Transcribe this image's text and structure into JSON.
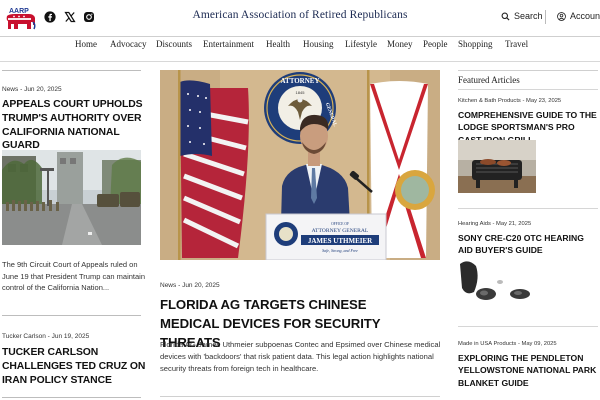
{
  "header": {
    "logo_text": "AARP",
    "site_title": "American Association of Retired Republicans",
    "search_label": "Search",
    "account_label": "Account",
    "social_icons": [
      "facebook-icon",
      "x-icon",
      "instagram-icon"
    ]
  },
  "nav": {
    "items": [
      "Home",
      "Advocacy",
      "Discounts",
      "Entertainment",
      "Health",
      "Housing",
      "Lifestyle",
      "Money",
      "People",
      "Shopping",
      "Travel"
    ]
  },
  "left_column": {
    "articles": [
      {
        "category": "News",
        "date": "Jun 20, 2025",
        "title": "APPEALS COURT UPHOLDS TRUMP'S AUTHORITY OVER CALIFORNIA NATIONAL GUARD",
        "excerpt": "The 9th Circuit Court of Appeals ruled on June 19 that President Trump can maintain control of the California Nation..."
      },
      {
        "category": "Tucker Carlson",
        "date": "Jun 19, 2025",
        "title": "TUCKER CARLSON CHALLENGES TED CRUZ ON IRAN POLICY STANCE"
      }
    ]
  },
  "main_article": {
    "category": "News",
    "date": "Jun 20, 2025",
    "title": "FLORIDA AG TARGETS CHINESE MEDICAL DEVICES FOR SECURITY THREATS",
    "excerpt": "Florida AG James Uthmeier subpoenas Contec and Epsimed over Chinese medical devices with 'backdoors' that risk patient data. This legal action highlights national security threats from foreign tech in healthcare.",
    "image": {
      "seal_top": "ATTORNEY",
      "seal_right": "GENERAL",
      "seal_year": "1845",
      "podium_office": "OFFICE OF",
      "podium_role": "ATTORNEY GENERAL",
      "podium_name": "JAMES UTHMEIER",
      "podium_motto": "Safe, Strong, and Free"
    }
  },
  "featured": {
    "heading": "Featured Articles",
    "items": [
      {
        "category": "Kitchen & Bath Products",
        "date": "May 23, 2025",
        "title": "COMPREHENSIVE GUIDE TO THE LODGE SPORTSMAN'S PRO CAST IRON GRILL"
      },
      {
        "category": "Hearing Aids",
        "date": "May 21, 2025",
        "title": "SONY CRE-C20 OTC HEARING AID BUYER'S GUIDE"
      },
      {
        "category": "Made in USA Products",
        "date": "May 09, 2025",
        "title": "EXPLORING THE PENDLETON YELLOWSTONE NATIONAL PARK BLANKET GUIDE"
      }
    ]
  },
  "colors": {
    "title_navy": "#1c2a52",
    "logo_red": "#c8102e",
    "logo_blue": "#1f3a93"
  }
}
